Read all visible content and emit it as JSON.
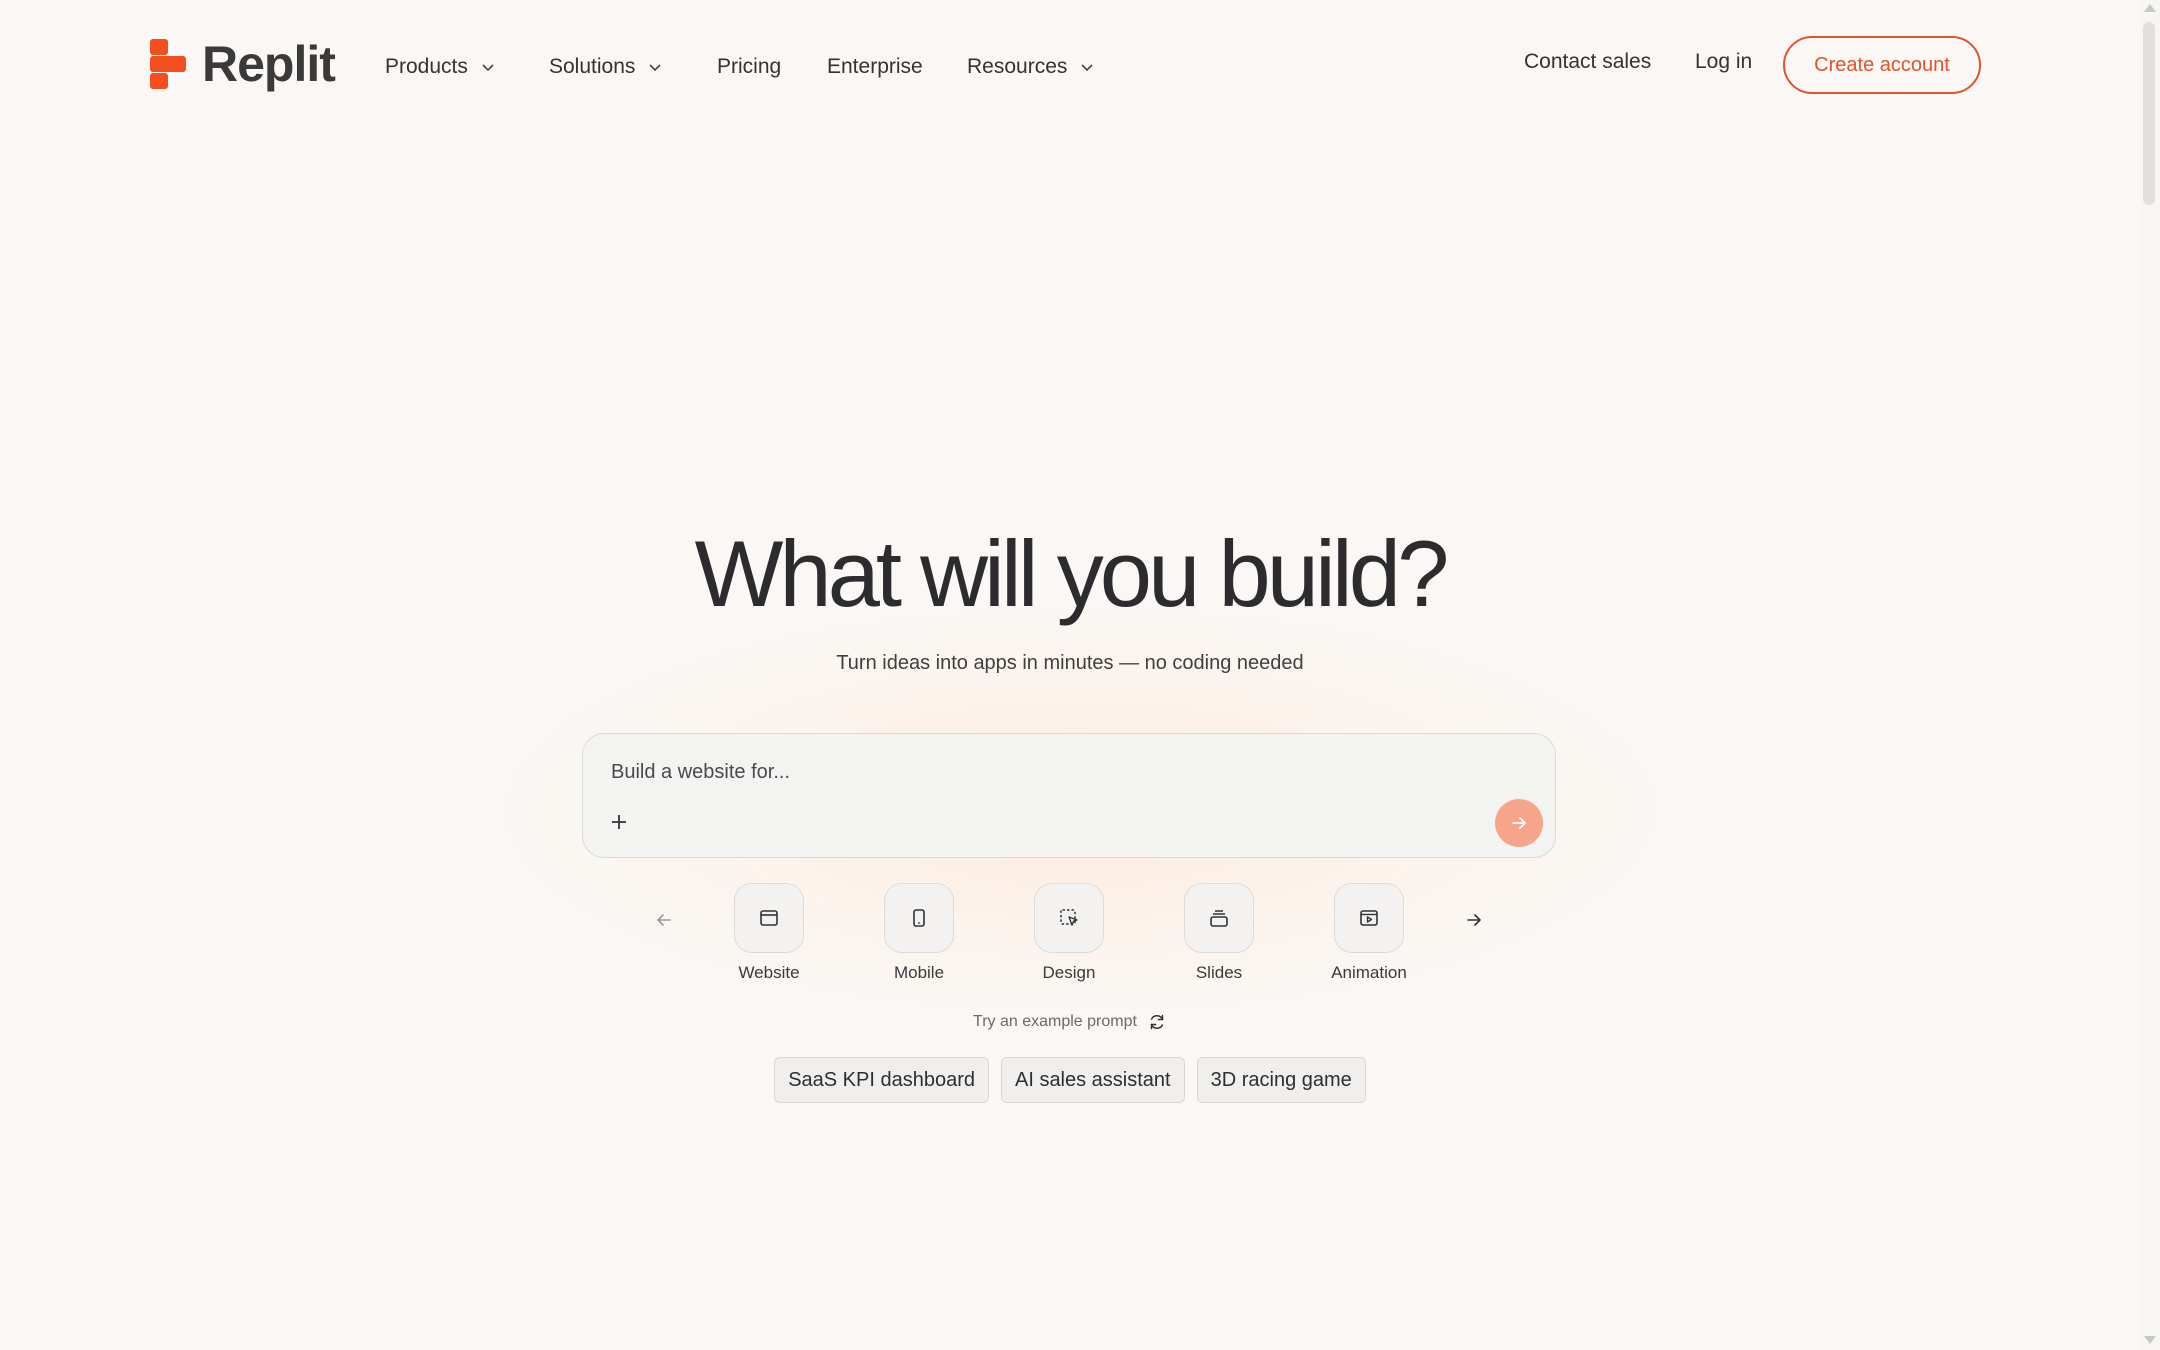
{
  "brand": {
    "name": "Replit",
    "accent": "#f24e1e",
    "cta_color": "#e0542b"
  },
  "nav": {
    "products": "Products",
    "solutions": "Solutions",
    "pricing": "Pricing",
    "enterprise": "Enterprise",
    "resources": "Resources"
  },
  "header_actions": {
    "contact_sales": "Contact sales",
    "log_in": "Log in",
    "create_account": "Create account"
  },
  "hero": {
    "title": "What will you build?",
    "subtitle": "Turn ideas into apps in minutes — no coding needed"
  },
  "prompt": {
    "placeholder": "Build a website for...",
    "value": "",
    "add_icon": "plus-icon",
    "send_icon": "arrow-right-icon"
  },
  "categories": [
    {
      "label": "Website",
      "icon": "browser-window-icon"
    },
    {
      "label": "Mobile",
      "icon": "phone-icon"
    },
    {
      "label": "Design",
      "icon": "selection-cursor-icon"
    },
    {
      "label": "Slides",
      "icon": "stack-icon"
    },
    {
      "label": "Animation",
      "icon": "play-window-icon"
    }
  ],
  "examples": {
    "label": "Try an example prompt",
    "chips": [
      "SaaS KPI dashboard",
      "AI sales assistant",
      "3D racing game"
    ]
  }
}
